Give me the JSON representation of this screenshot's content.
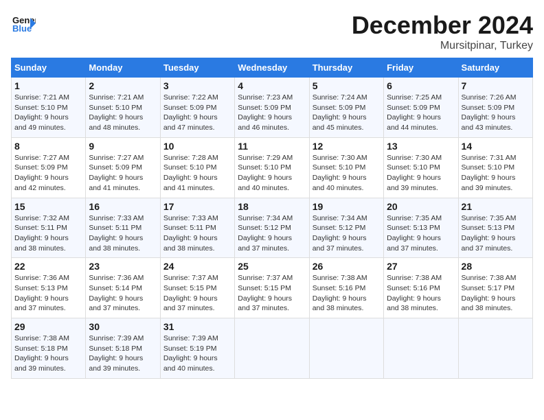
{
  "header": {
    "logo_line1": "General",
    "logo_line2": "Blue",
    "month_title": "December 2024",
    "location": "Mursitpinar, Turkey"
  },
  "weekdays": [
    "Sunday",
    "Monday",
    "Tuesday",
    "Wednesday",
    "Thursday",
    "Friday",
    "Saturday"
  ],
  "weeks": [
    [
      {
        "day": "1",
        "info": "Sunrise: 7:21 AM\nSunset: 5:10 PM\nDaylight: 9 hours\nand 49 minutes."
      },
      {
        "day": "2",
        "info": "Sunrise: 7:21 AM\nSunset: 5:10 PM\nDaylight: 9 hours\nand 48 minutes."
      },
      {
        "day": "3",
        "info": "Sunrise: 7:22 AM\nSunset: 5:09 PM\nDaylight: 9 hours\nand 47 minutes."
      },
      {
        "day": "4",
        "info": "Sunrise: 7:23 AM\nSunset: 5:09 PM\nDaylight: 9 hours\nand 46 minutes."
      },
      {
        "day": "5",
        "info": "Sunrise: 7:24 AM\nSunset: 5:09 PM\nDaylight: 9 hours\nand 45 minutes."
      },
      {
        "day": "6",
        "info": "Sunrise: 7:25 AM\nSunset: 5:09 PM\nDaylight: 9 hours\nand 44 minutes."
      },
      {
        "day": "7",
        "info": "Sunrise: 7:26 AM\nSunset: 5:09 PM\nDaylight: 9 hours\nand 43 minutes."
      }
    ],
    [
      {
        "day": "8",
        "info": "Sunrise: 7:27 AM\nSunset: 5:09 PM\nDaylight: 9 hours\nand 42 minutes."
      },
      {
        "day": "9",
        "info": "Sunrise: 7:27 AM\nSunset: 5:09 PM\nDaylight: 9 hours\nand 41 minutes."
      },
      {
        "day": "10",
        "info": "Sunrise: 7:28 AM\nSunset: 5:10 PM\nDaylight: 9 hours\nand 41 minutes."
      },
      {
        "day": "11",
        "info": "Sunrise: 7:29 AM\nSunset: 5:10 PM\nDaylight: 9 hours\nand 40 minutes."
      },
      {
        "day": "12",
        "info": "Sunrise: 7:30 AM\nSunset: 5:10 PM\nDaylight: 9 hours\nand 40 minutes."
      },
      {
        "day": "13",
        "info": "Sunrise: 7:30 AM\nSunset: 5:10 PM\nDaylight: 9 hours\nand 39 minutes."
      },
      {
        "day": "14",
        "info": "Sunrise: 7:31 AM\nSunset: 5:10 PM\nDaylight: 9 hours\nand 39 minutes."
      }
    ],
    [
      {
        "day": "15",
        "info": "Sunrise: 7:32 AM\nSunset: 5:11 PM\nDaylight: 9 hours\nand 38 minutes."
      },
      {
        "day": "16",
        "info": "Sunrise: 7:33 AM\nSunset: 5:11 PM\nDaylight: 9 hours\nand 38 minutes."
      },
      {
        "day": "17",
        "info": "Sunrise: 7:33 AM\nSunset: 5:11 PM\nDaylight: 9 hours\nand 38 minutes."
      },
      {
        "day": "18",
        "info": "Sunrise: 7:34 AM\nSunset: 5:12 PM\nDaylight: 9 hours\nand 37 minutes."
      },
      {
        "day": "19",
        "info": "Sunrise: 7:34 AM\nSunset: 5:12 PM\nDaylight: 9 hours\nand 37 minutes."
      },
      {
        "day": "20",
        "info": "Sunrise: 7:35 AM\nSunset: 5:13 PM\nDaylight: 9 hours\nand 37 minutes."
      },
      {
        "day": "21",
        "info": "Sunrise: 7:35 AM\nSunset: 5:13 PM\nDaylight: 9 hours\nand 37 minutes."
      }
    ],
    [
      {
        "day": "22",
        "info": "Sunrise: 7:36 AM\nSunset: 5:13 PM\nDaylight: 9 hours\nand 37 minutes."
      },
      {
        "day": "23",
        "info": "Sunrise: 7:36 AM\nSunset: 5:14 PM\nDaylight: 9 hours\nand 37 minutes."
      },
      {
        "day": "24",
        "info": "Sunrise: 7:37 AM\nSunset: 5:15 PM\nDaylight: 9 hours\nand 37 minutes."
      },
      {
        "day": "25",
        "info": "Sunrise: 7:37 AM\nSunset: 5:15 PM\nDaylight: 9 hours\nand 37 minutes."
      },
      {
        "day": "26",
        "info": "Sunrise: 7:38 AM\nSunset: 5:16 PM\nDaylight: 9 hours\nand 38 minutes."
      },
      {
        "day": "27",
        "info": "Sunrise: 7:38 AM\nSunset: 5:16 PM\nDaylight: 9 hours\nand 38 minutes."
      },
      {
        "day": "28",
        "info": "Sunrise: 7:38 AM\nSunset: 5:17 PM\nDaylight: 9 hours\nand 38 minutes."
      }
    ],
    [
      {
        "day": "29",
        "info": "Sunrise: 7:38 AM\nSunset: 5:18 PM\nDaylight: 9 hours\nand 39 minutes."
      },
      {
        "day": "30",
        "info": "Sunrise: 7:39 AM\nSunset: 5:18 PM\nDaylight: 9 hours\nand 39 minutes."
      },
      {
        "day": "31",
        "info": "Sunrise: 7:39 AM\nSunset: 5:19 PM\nDaylight: 9 hours\nand 40 minutes."
      },
      null,
      null,
      null,
      null
    ]
  ]
}
